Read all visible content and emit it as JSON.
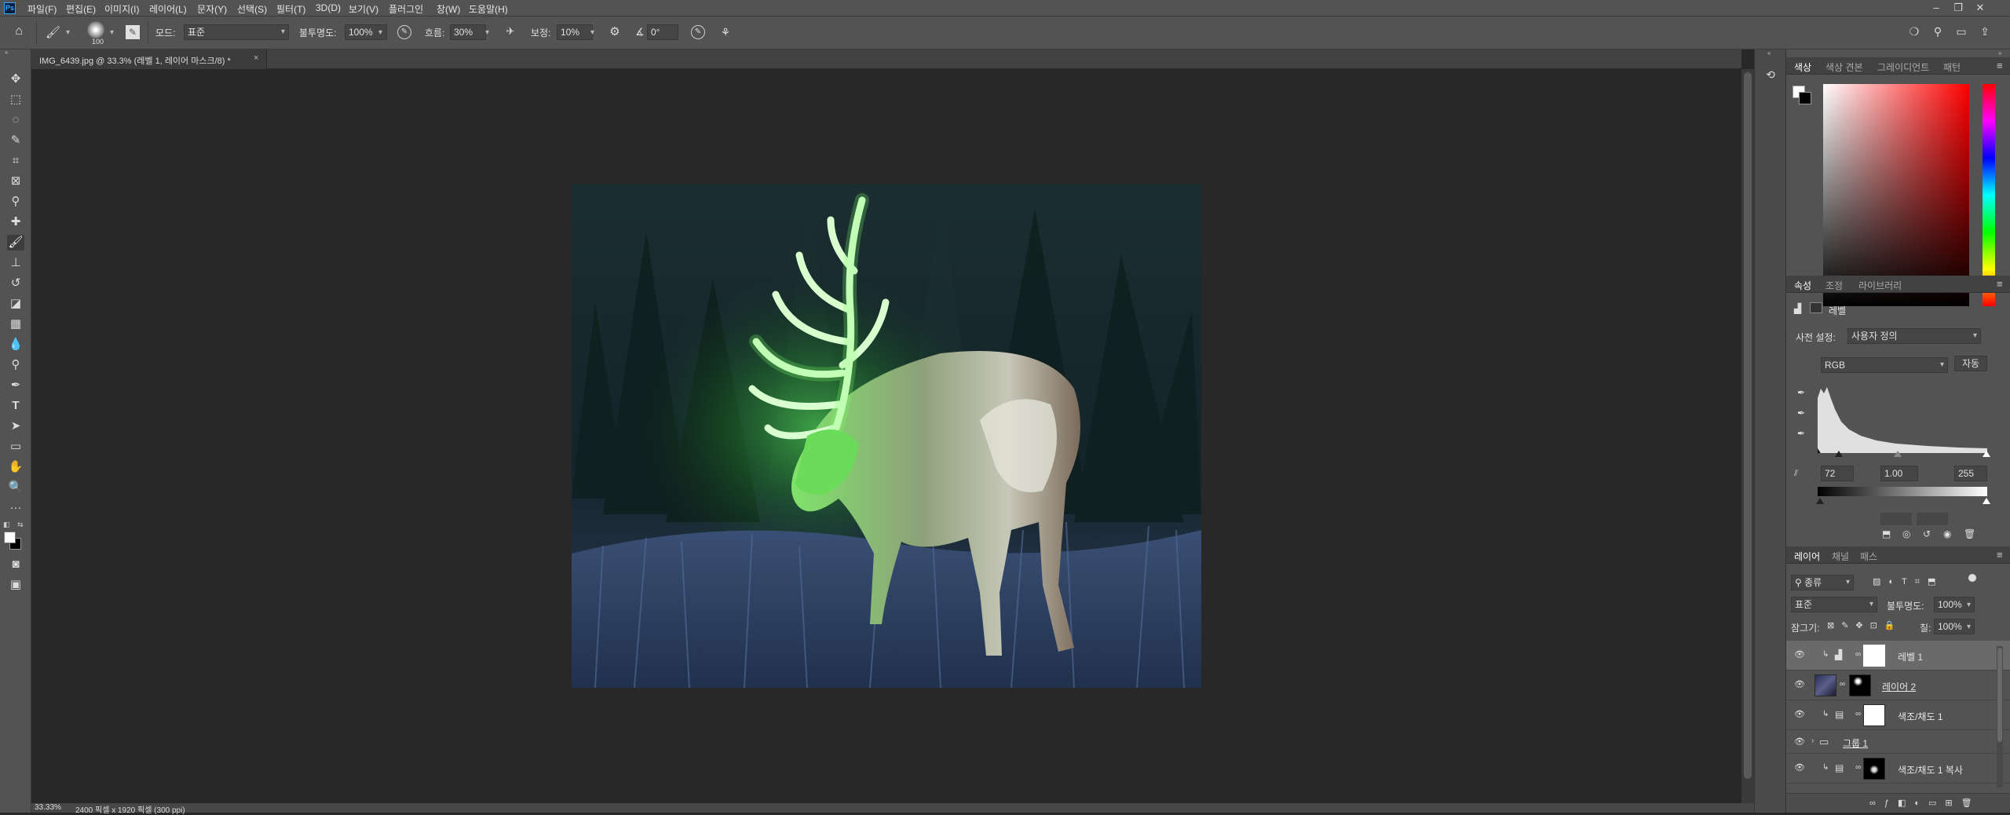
{
  "app": {
    "logo": "Ps"
  },
  "menu": [
    "파일(F)",
    "편집(E)",
    "이미지(I)",
    "레이어(L)",
    "문자(Y)",
    "선택(S)",
    "필터(T)",
    "3D(D)",
    "보기(V)",
    "플러그인",
    "창(W)",
    "도움말(H)"
  ],
  "options": {
    "brush_size": "100",
    "mode_label": "모드:",
    "mode_value": "표준",
    "opacity_label": "불투명도:",
    "opacity_value": "100%",
    "flow_label": "흐름:",
    "flow_value": "30%",
    "smoothing_label": "보정:",
    "smoothing_value": "10%",
    "angle_value": "0°"
  },
  "document": {
    "tab_title": "IMG_6439.jpg @ 33.3% (레벨 1, 레이어 마스크/8) *",
    "status_zoom": "33.33%",
    "status_info": "2400 픽셀 x 1920 픽셀 (300 ppi)"
  },
  "color_panel": {
    "tabs": [
      "색상",
      "색상 견본",
      "그레이디언트",
      "패턴"
    ]
  },
  "properties": {
    "tabs": [
      "속성",
      "조정",
      "라이브러리"
    ],
    "title": "레벨",
    "preset_label": "사전 설정:",
    "preset_value": "사용자 정의",
    "channel": "RGB",
    "auto_label": "자동",
    "input_black": "72",
    "input_gamma": "1.00",
    "input_white": "255"
  },
  "layers_panel": {
    "tabs": [
      "레이어",
      "채널",
      "패스"
    ],
    "filter_label": "종류",
    "blend_mode": "표준",
    "opacity_label": "불투명도:",
    "opacity_value": "100%",
    "lock_label": "잠그기:",
    "fill_label": "칠:",
    "fill_value": "100%",
    "layers": [
      {
        "name": "레벨 1",
        "selected": true
      },
      {
        "name": "레이어 2",
        "selected": false
      },
      {
        "name": "색조/채도 1",
        "selected": false
      },
      {
        "name": "그룹 1",
        "selected": false
      },
      {
        "name": "색조/채도 1 복사",
        "selected": false
      }
    ]
  },
  "colors": {
    "ui_dark": "#282828",
    "panel": "#535353",
    "glow": "#4cff4c",
    "accent": "#31a8ff"
  }
}
